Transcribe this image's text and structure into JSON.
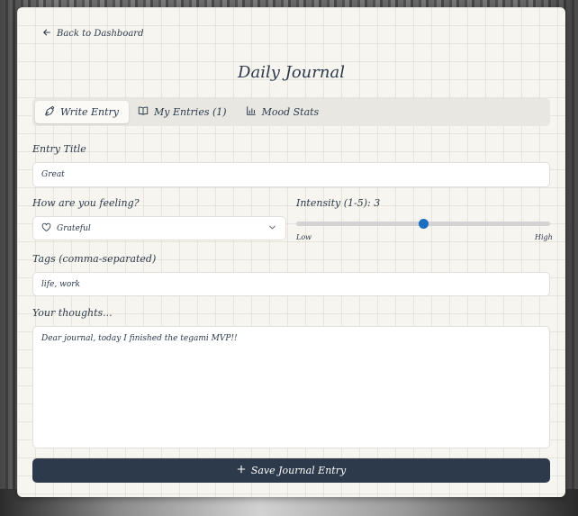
{
  "nav": {
    "back_label": "Back to Dashboard"
  },
  "header": {
    "title": "Daily Journal"
  },
  "tabs": [
    {
      "label": "Write Entry",
      "icon": "pen-nib-icon",
      "active": true
    },
    {
      "label": "My Entries (1)",
      "icon": "book-open-icon",
      "active": false
    },
    {
      "label": "Mood Stats",
      "icon": "bar-chart-icon",
      "active": false
    }
  ],
  "form": {
    "title_label": "Entry Title",
    "title_value": "Great",
    "mood_label": "How are you feeling?",
    "mood_value": "Grateful",
    "mood_icon": "heart-icon",
    "intensity_label": "Intensity (1-5): 3",
    "intensity_value": 3,
    "intensity_min": 1,
    "intensity_max": 5,
    "intensity_low": "Low",
    "intensity_high": "High",
    "tags_label": "Tags (comma-separated)",
    "tags_value": "life, work",
    "thoughts_label": "Your thoughts...",
    "thoughts_value": "Dear journal, today I finished the tegami MVP!!"
  },
  "actions": {
    "save_label": "Save Journal Entry",
    "save_icon": "plus-icon"
  },
  "colors": {
    "primary": "#2d3a4b",
    "accent": "#1c6fc0",
    "card": "#f7f5ef"
  }
}
